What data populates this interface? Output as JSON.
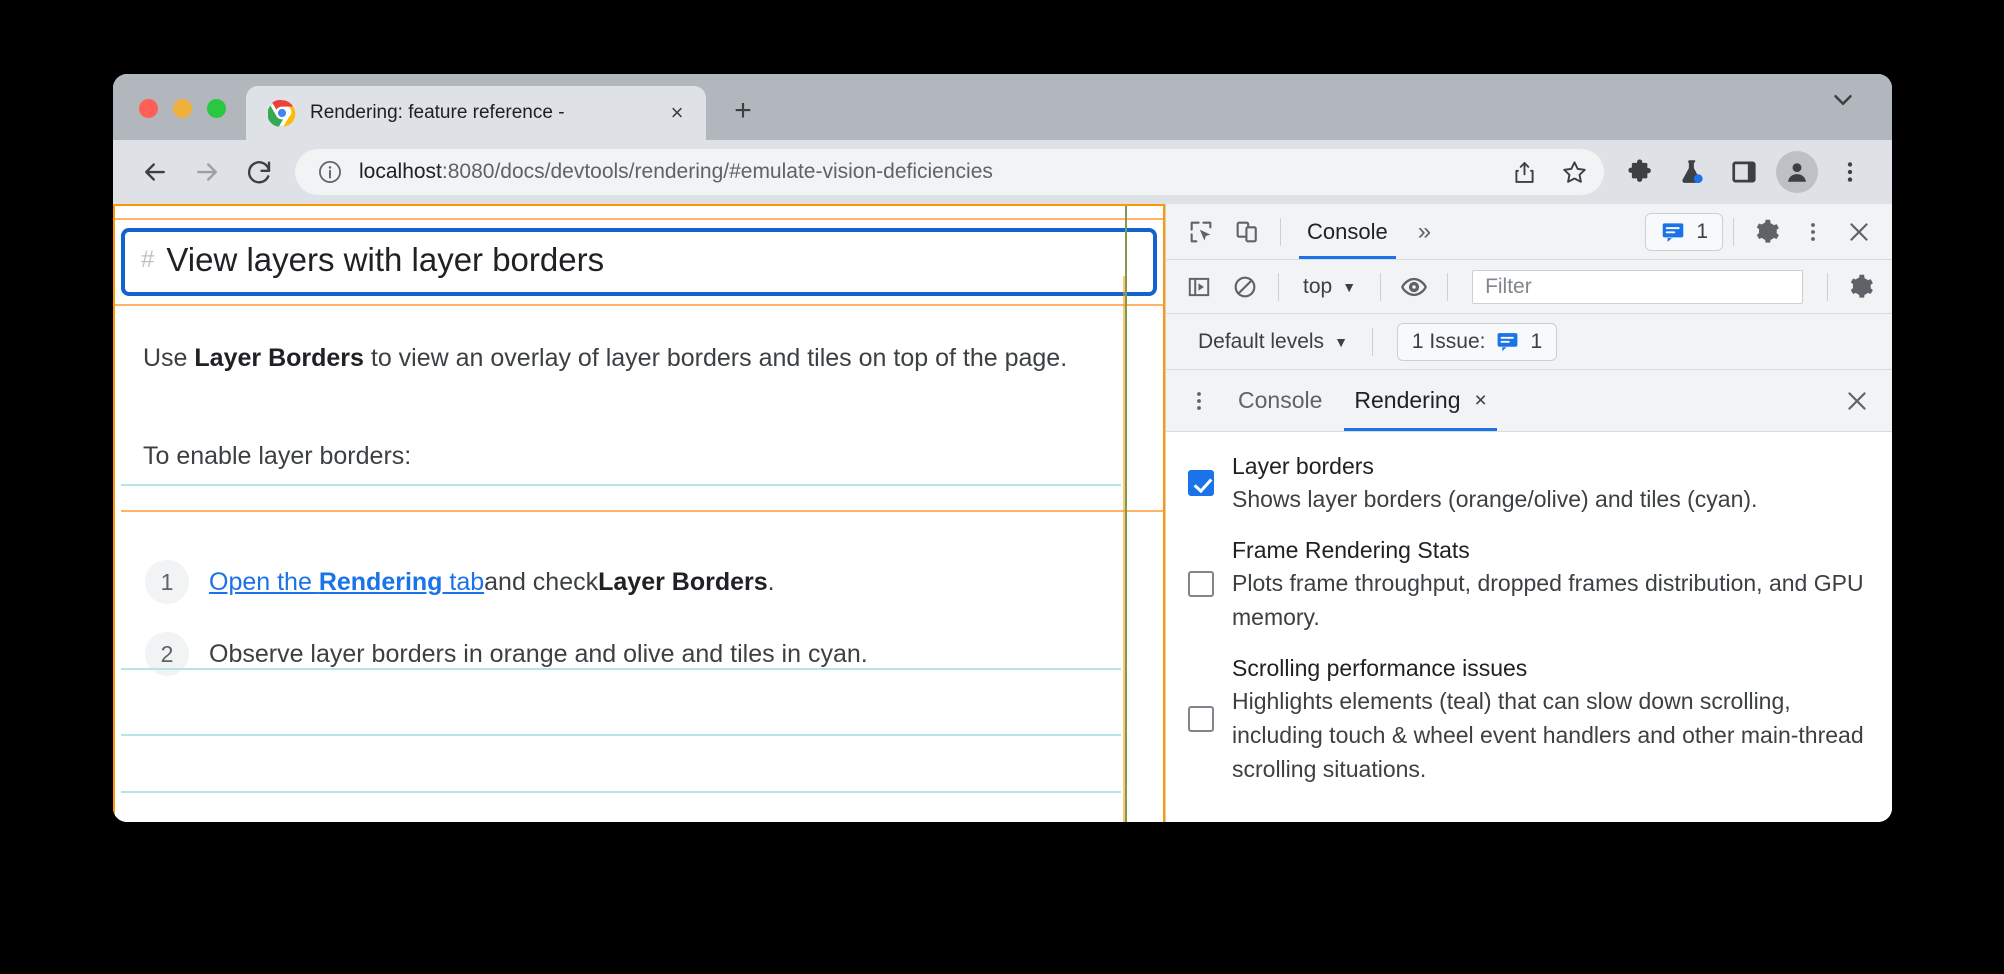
{
  "window": {
    "tab": {
      "title": "Rendering: feature reference -",
      "favicon": "chrome-logo-icon",
      "close_label": "×"
    },
    "new_tab_label": "+",
    "tabstrip_chevron": "chevron-down-icon"
  },
  "toolbar": {
    "back": "back-arrow-icon",
    "forward": "forward-arrow-icon",
    "reload": "reload-icon",
    "site_info": "info-circle-icon",
    "url_host": "localhost",
    "url_rest": ":8080/docs/devtools/rendering/#emulate-vision-deficiencies",
    "share": "share-icon",
    "bookmark": "star-icon",
    "extensions": "puzzle-icon",
    "experiments": "flask-icon",
    "side_panel": "side-panel-icon",
    "profile": "person-avatar-icon",
    "menu": "three-dots-vertical-icon"
  },
  "page": {
    "heading_hash": "#",
    "heading": "View layers with layer borders",
    "para_pre": "Use ",
    "para_bold": "Layer Borders",
    "para_post": " to view an overlay of layer borders and tiles on top of the page.",
    "enable_text": "To enable layer borders:",
    "steps": [
      {
        "num": "1",
        "link_pre": "Open the ",
        "link_bold": "Rendering",
        "link_post": " tab",
        "after_pre": " and check ",
        "after_bold": "Layer Borders",
        "after_post": "."
      },
      {
        "num": "2",
        "text": "Observe layer borders in orange and olive and tiles in cyan."
      }
    ],
    "overlay_colors": {
      "layer_border_orange": "#ff9800",
      "layer_border_olive": "#7f9b52",
      "composited_layer_blue": "#1263cd",
      "tile_cyan": "#b7e4e4"
    }
  },
  "devtools": {
    "main_toolbar": {
      "inspect": "inspect-cursor-icon",
      "device_toggle": "device-toolbar-icon",
      "tab_console": "Console",
      "more_tabs": "»",
      "issues_count": "1",
      "issues_icon": "issue-message-icon",
      "settings": "gear-icon",
      "more": "three-dots-vertical-icon",
      "close": "close-icon"
    },
    "console_toolbar": {
      "sidebar_toggle": "console-sidebar-icon",
      "clear": "clear-console-icon",
      "context": "top",
      "context_caret": "▼",
      "eye": "eye-icon",
      "filter_placeholder": "Filter",
      "filter_value": "",
      "settings": "gear-icon"
    },
    "levels_row": {
      "levels": "Default levels",
      "levels_caret": "▼",
      "issues_label": "1 Issue:",
      "issues_icon": "issue-message-icon",
      "issues_count": "1"
    },
    "drawer": {
      "menu": "three-dots-vertical-icon",
      "tabs": [
        {
          "label": "Console",
          "active": false,
          "closable": false
        },
        {
          "label": "Rendering",
          "active": true,
          "closable": true,
          "close": "×"
        }
      ],
      "close": "close-icon"
    },
    "rendering": [
      {
        "checked": true,
        "title": "Layer borders",
        "desc": "Shows layer borders (orange/olive) and tiles (cyan)."
      },
      {
        "checked": false,
        "title": "Frame Rendering Stats",
        "desc": "Plots frame throughput, dropped frames distribution, and GPU memory."
      },
      {
        "checked": false,
        "title": "Scrolling performance issues",
        "desc": "Highlights elements (teal) that can slow down scrolling, including touch & wheel event handlers and other main-thread scrolling situations."
      }
    ]
  }
}
